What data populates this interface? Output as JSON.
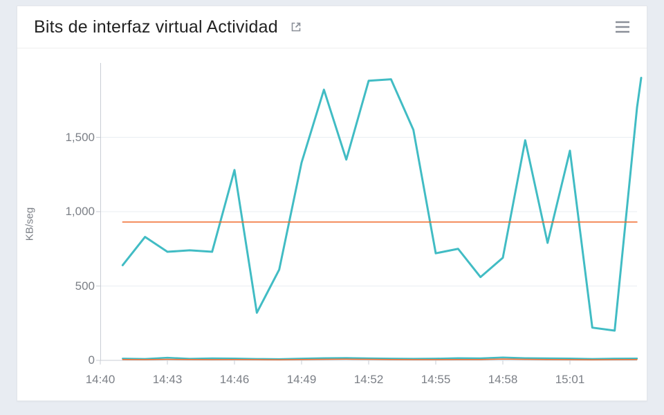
{
  "header": {
    "title": "Bits de interfaz virtual Actividad"
  },
  "chart_data": {
    "type": "line",
    "ylabel": "KB/seg",
    "xlabel": "",
    "xlim_minutes": [
      880,
      904
    ],
    "ylim": [
      0,
      2000
    ],
    "x_tick_every_minutes": 3,
    "x_tick_labels": [
      "14:40",
      "14:43",
      "14:46",
      "14:49",
      "14:52",
      "14:55",
      "14:58",
      "15:01"
    ],
    "y_ticks": [
      0,
      500,
      1000,
      1500
    ],
    "x_minutes": [
      881,
      882,
      883,
      884,
      885,
      886,
      887,
      888,
      889,
      890,
      891,
      892,
      893,
      894,
      895,
      896,
      897,
      898,
      899,
      900,
      901,
      902,
      903,
      904
    ],
    "series": [
      {
        "name": "primary",
        "color": "#41bcc4",
        "width": 3,
        "values": [
          640,
          830,
          730,
          740,
          730,
          1280,
          320,
          610,
          1330,
          1820,
          1350,
          1880,
          1890,
          1550,
          720,
          750,
          560,
          690,
          1480,
          790,
          1410,
          220,
          200,
          1700
        ]
      },
      {
        "name": "avg_high",
        "color": "#f06a2b",
        "width": 1.5,
        "values": [
          930,
          930,
          930,
          930,
          930,
          930,
          930,
          930,
          930,
          930,
          930,
          930,
          930,
          930,
          930,
          930,
          930,
          930,
          930,
          930,
          930,
          930,
          930,
          930
        ]
      },
      {
        "name": "low_teal",
        "color": "#41bcc4",
        "width": 2.5,
        "values": [
          12,
          10,
          18,
          11,
          14,
          13,
          10,
          9,
          12,
          15,
          16,
          14,
          12,
          11,
          12,
          15,
          14,
          20,
          15,
          14,
          13,
          10,
          12,
          13
        ]
      },
      {
        "name": "low_orange",
        "color": "#f06a2b",
        "width": 1.5,
        "values": [
          6,
          5,
          7,
          6,
          5,
          6,
          5,
          4,
          6,
          7,
          8,
          7,
          6,
          5,
          5,
          6,
          6,
          9,
          7,
          6,
          5,
          4,
          5,
          6
        ]
      }
    ]
  },
  "colors": {
    "axis": "#c9cdd4",
    "text": "#7b7f86"
  }
}
